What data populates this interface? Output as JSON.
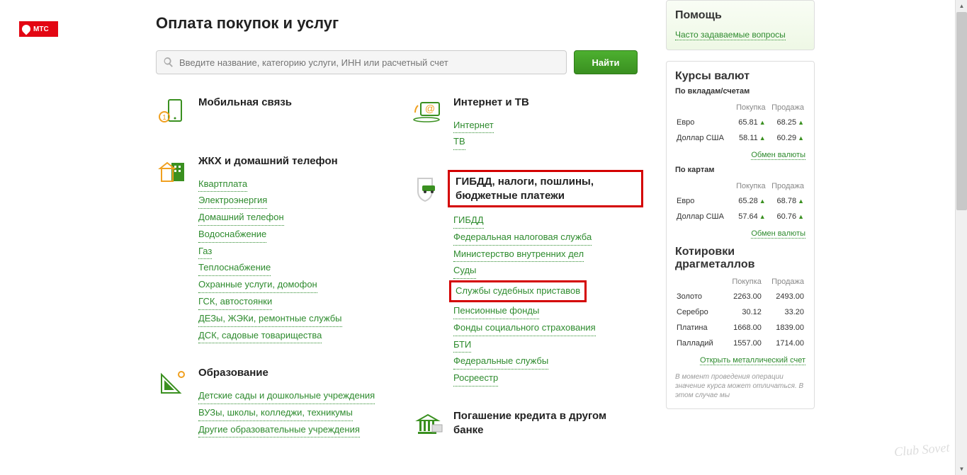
{
  "mts": "МТС",
  "title": "Оплата покупок и услуг",
  "search": {
    "placeholder": "Введите название, категорию услуги, ИНН или расчетный счет",
    "button": "Найти"
  },
  "cats": {
    "mobile": {
      "title": "Мобильная связь"
    },
    "zkh": {
      "title": "ЖКХ и домашний телефон",
      "links": [
        "Квартплата",
        "Электроэнергия",
        "Домашний телефон",
        "Водоснабжение",
        "Газ",
        "Теплоснабжение",
        "Охранные услуги, домофон",
        "ГСК, автостоянки",
        "ДЕЗы, ЖЭКи, ремонтные службы",
        "ДСК, садовые товарищества"
      ]
    },
    "edu": {
      "title": "Образование",
      "links": [
        "Детские сады и дошкольные учреждения",
        "ВУЗы, школы, колледжи, техникумы",
        "Другие образовательные учреждения"
      ]
    },
    "inet": {
      "title": "Интернет и ТВ",
      "links": [
        "Интернет",
        "ТВ"
      ]
    },
    "gibdd": {
      "title": "ГИБДД, налоги, пошлины, бюджетные платежи",
      "links": [
        "ГИБДД",
        "Федеральная налоговая служба",
        "Министерство внутренних дел",
        "Суды",
        "Службы судебных приставов",
        "Пенсионные фонды",
        "Фонды социального страхования",
        "БТИ",
        "Федеральные службы",
        "Росреестр"
      ]
    },
    "credit": {
      "title": "Погашение кредита в другом банке"
    }
  },
  "help": {
    "title": "Помощь",
    "faq": "Часто задаваемые вопросы"
  },
  "rates": {
    "title": "Курсы валют",
    "sub1": "По вкладам/счетам",
    "sub2": "По картам",
    "cols": {
      "buy": "Покупка",
      "sell": "Продажа"
    },
    "deposits": [
      {
        "name": "Евро",
        "buy": "65.81",
        "sell": "68.25"
      },
      {
        "name": "Доллар США",
        "buy": "58.11",
        "sell": "60.29"
      }
    ],
    "cards": [
      {
        "name": "Евро",
        "buy": "65.28",
        "sell": "68.78"
      },
      {
        "name": "Доллар США",
        "buy": "57.64",
        "sell": "60.76"
      }
    ],
    "exchange": "Обмен валюты"
  },
  "metals": {
    "title": "Котировки драгметаллов",
    "rows": [
      {
        "name": "Золото",
        "buy": "2263.00",
        "sell": "2493.00"
      },
      {
        "name": "Серебро",
        "buy": "30.12",
        "sell": "33.20"
      },
      {
        "name": "Платина",
        "buy": "1668.00",
        "sell": "1839.00"
      },
      {
        "name": "Палладий",
        "buy": "1557.00",
        "sell": "1714.00"
      }
    ],
    "link": "Открыть металлический счет",
    "note": "В момент проведения операции значение курса может отличаться. В этом случае мы"
  },
  "watermark": "Club Sovet"
}
